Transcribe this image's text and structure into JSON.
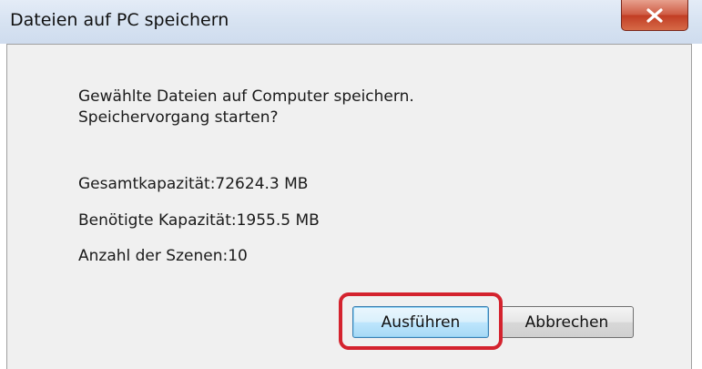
{
  "window": {
    "title": "Dateien auf PC speichern",
    "close_icon": "close-x-icon"
  },
  "message": {
    "line1": "Gewählte Dateien auf Computer speichern.",
    "line2": "Speichervorgang starten?"
  },
  "info": {
    "total_capacity": "Gesamtkapazität:72624.3 MB",
    "required_capacity": "Benötigte Kapazität:1955.5 MB",
    "scene_count": "Anzahl der Szenen:10"
  },
  "buttons": {
    "execute_label": "Ausführen",
    "cancel_label": "Abbrechen"
  },
  "colors": {
    "highlight": "#d4232e",
    "close_button": "#c13d24"
  }
}
